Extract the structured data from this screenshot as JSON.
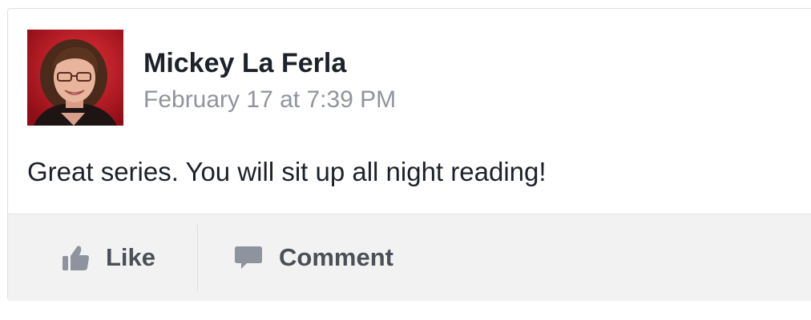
{
  "post": {
    "author_name": "Mickey La Ferla",
    "timestamp": "February 17 at 7:39 PM",
    "message": "Great series. You will sit up all night reading!",
    "avatar_icon": "profile-photo"
  },
  "actions": {
    "like_label": "Like",
    "like_icon": "thumbs-up-icon",
    "comment_label": "Comment",
    "comment_icon": "speech-bubble-icon"
  },
  "colors": {
    "name_text": "#1d2129",
    "timestamp_text": "#90949c",
    "action_text": "#4b4f56",
    "icon_gray": "#8d949e",
    "action_bar_bg": "#f2f2f2"
  }
}
